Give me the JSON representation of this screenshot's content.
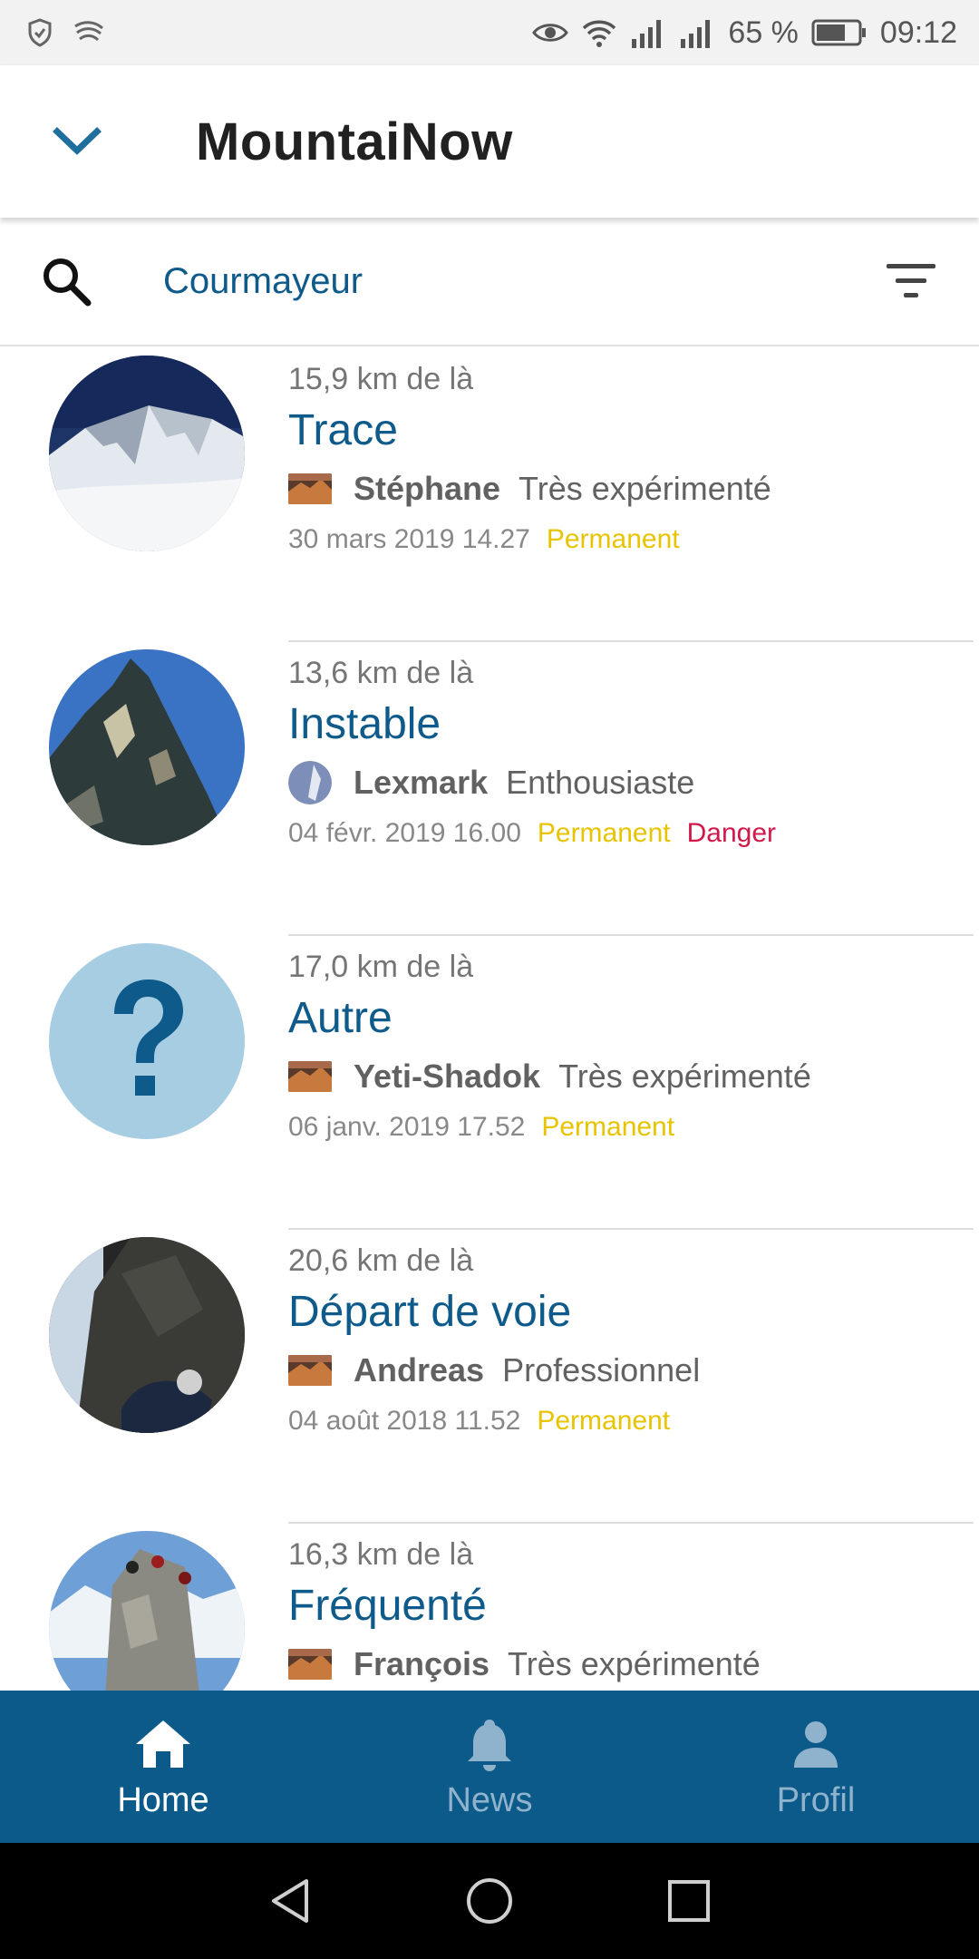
{
  "status_bar": {
    "battery": "65 %",
    "time": "09:12",
    "icons": [
      "shield-icon",
      "swiftkey-icon",
      "eye-icon",
      "wifi-icon",
      "signal-icon",
      "signal-icon"
    ]
  },
  "app_bar": {
    "title": "MountaiNow",
    "collapse_icon": "chevron-down-icon"
  },
  "search": {
    "location": "Courmayeur",
    "search_icon": "search-icon",
    "filter_icon": "filter-icon"
  },
  "list": [
    {
      "distance": "15,9 km de là",
      "title": "Trace",
      "user": "Stéphane",
      "level": "Très expérimenté",
      "date": "30 mars 2019 14.27",
      "tags": [
        "Permanent"
      ],
      "avatar": "snow-mountain"
    },
    {
      "distance": "13,6 km de là",
      "title": "Instable",
      "user": "Lexmark",
      "level": "Enthousiaste",
      "date": "04 févr. 2019 16.00",
      "tags": [
        "Permanent",
        "Danger"
      ],
      "avatar": "rock-peak"
    },
    {
      "distance": "17,0 km de là",
      "title": "Autre",
      "user": "Yeti-Shadok",
      "level": "Très expérimenté",
      "date": "06 janv. 2019 17.52",
      "tags": [
        "Permanent"
      ],
      "avatar": "question-mark"
    },
    {
      "distance": "20,6 km de là",
      "title": "Départ de voie",
      "user": "Andreas",
      "level": "Professionnel",
      "date": "04 août 2018 11.52",
      "tags": [
        "Permanent"
      ],
      "avatar": "climber"
    },
    {
      "distance": "16,3 km de là",
      "title": "Fréquenté",
      "user": "François",
      "level": "Très expérimenté",
      "date": "",
      "tags": [],
      "avatar": "ridge"
    }
  ],
  "bottom_nav": {
    "items": [
      {
        "label": "Home",
        "icon": "home-icon",
        "active": true
      },
      {
        "label": "News",
        "icon": "bell-icon",
        "active": false
      },
      {
        "label": "Profil",
        "icon": "person-icon",
        "active": false
      }
    ]
  },
  "colors": {
    "accent": "#0e5a8a",
    "nav_bg": "#0c5a8a",
    "permanent": "#e8c400",
    "danger": "#d2184a"
  }
}
